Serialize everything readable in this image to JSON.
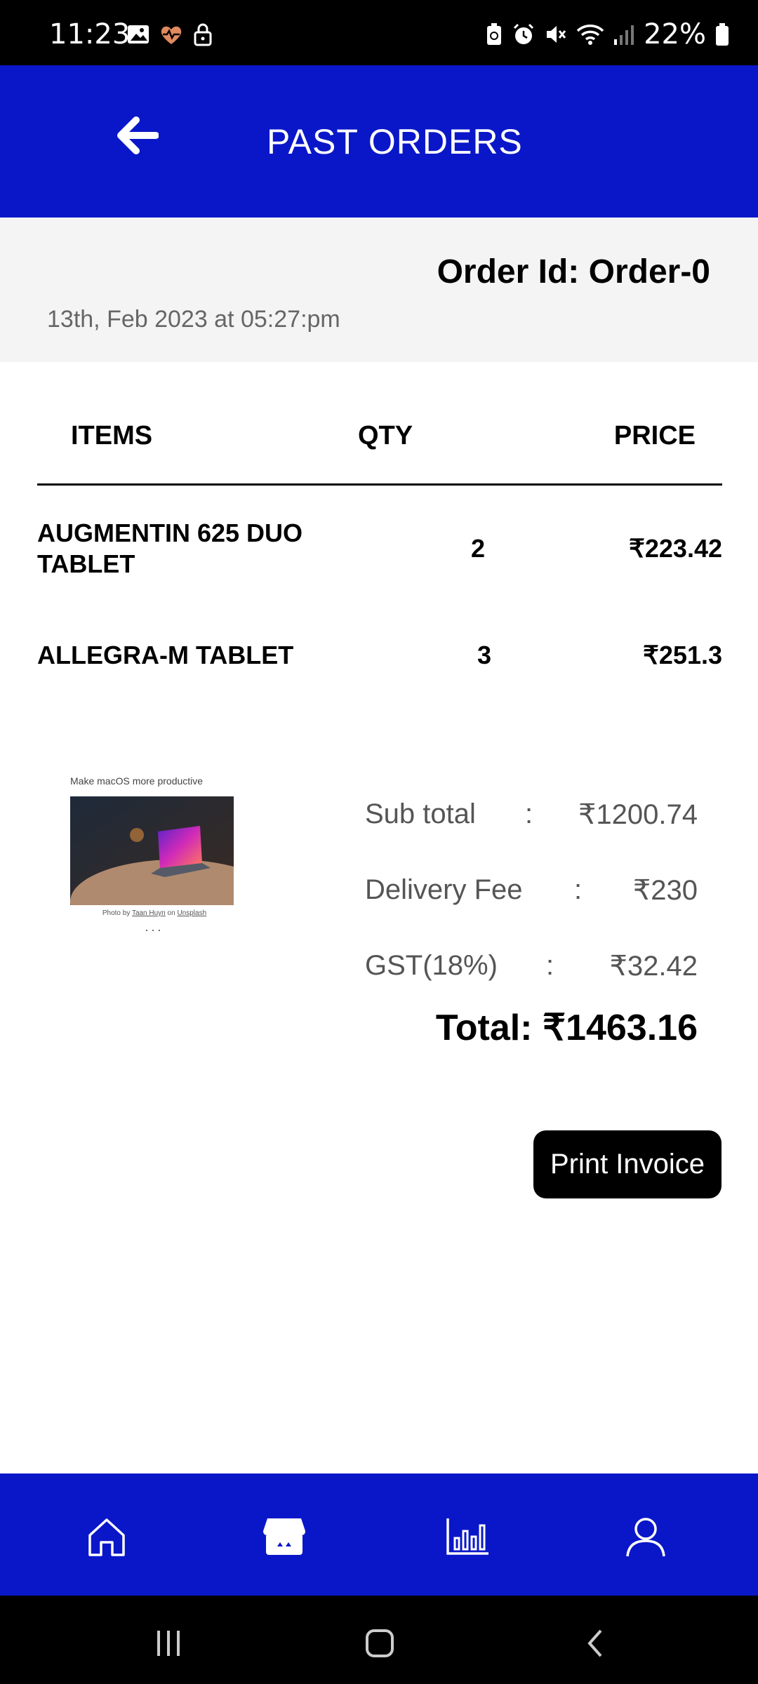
{
  "status_bar": {
    "time": "11:23",
    "battery": "22%"
  },
  "header": {
    "title": "PAST ORDERS"
  },
  "order": {
    "id_label": "Order Id: Order-0",
    "date": "13th, Feb 2023 at 05:27:pm"
  },
  "table": {
    "headers": {
      "items": "ITEMS",
      "qty": "QTY",
      "price": "PRICE"
    },
    "rows": [
      {
        "item_line1": "AUGMENTIN 625 DUO",
        "item_line2": "TABLET",
        "qty": "2",
        "price": "₹223.42"
      },
      {
        "item_line1": "ALLEGRA-M TABLET",
        "item_line2": "",
        "qty": "3",
        "price": "₹251.3"
      }
    ]
  },
  "ad": {
    "title": "Make macOS more productive",
    "caption_prefix": "Photo by",
    "caption_author": "Taan Huyn",
    "caption_on": "on",
    "caption_site": "Unsplash",
    "dots": "..."
  },
  "summary": {
    "subtotal_label": "Sub total",
    "subtotal_value": "₹1200.74",
    "delivery_label": "Delivery Fee",
    "delivery_value": "₹230",
    "gst_label": "GST(18%)",
    "gst_value": "₹32.42",
    "colon": ":",
    "total": "Total: ₹1463.16"
  },
  "actions": {
    "print_invoice": "Print Invoice"
  },
  "bottom_nav": {
    "items": [
      "home-icon",
      "store-icon",
      "chart-icon",
      "profile-icon"
    ],
    "active": "store-icon"
  },
  "colors": {
    "brand_blue": "#0a17c8",
    "black": "#000000",
    "header_bg": "#f4f4f4"
  }
}
